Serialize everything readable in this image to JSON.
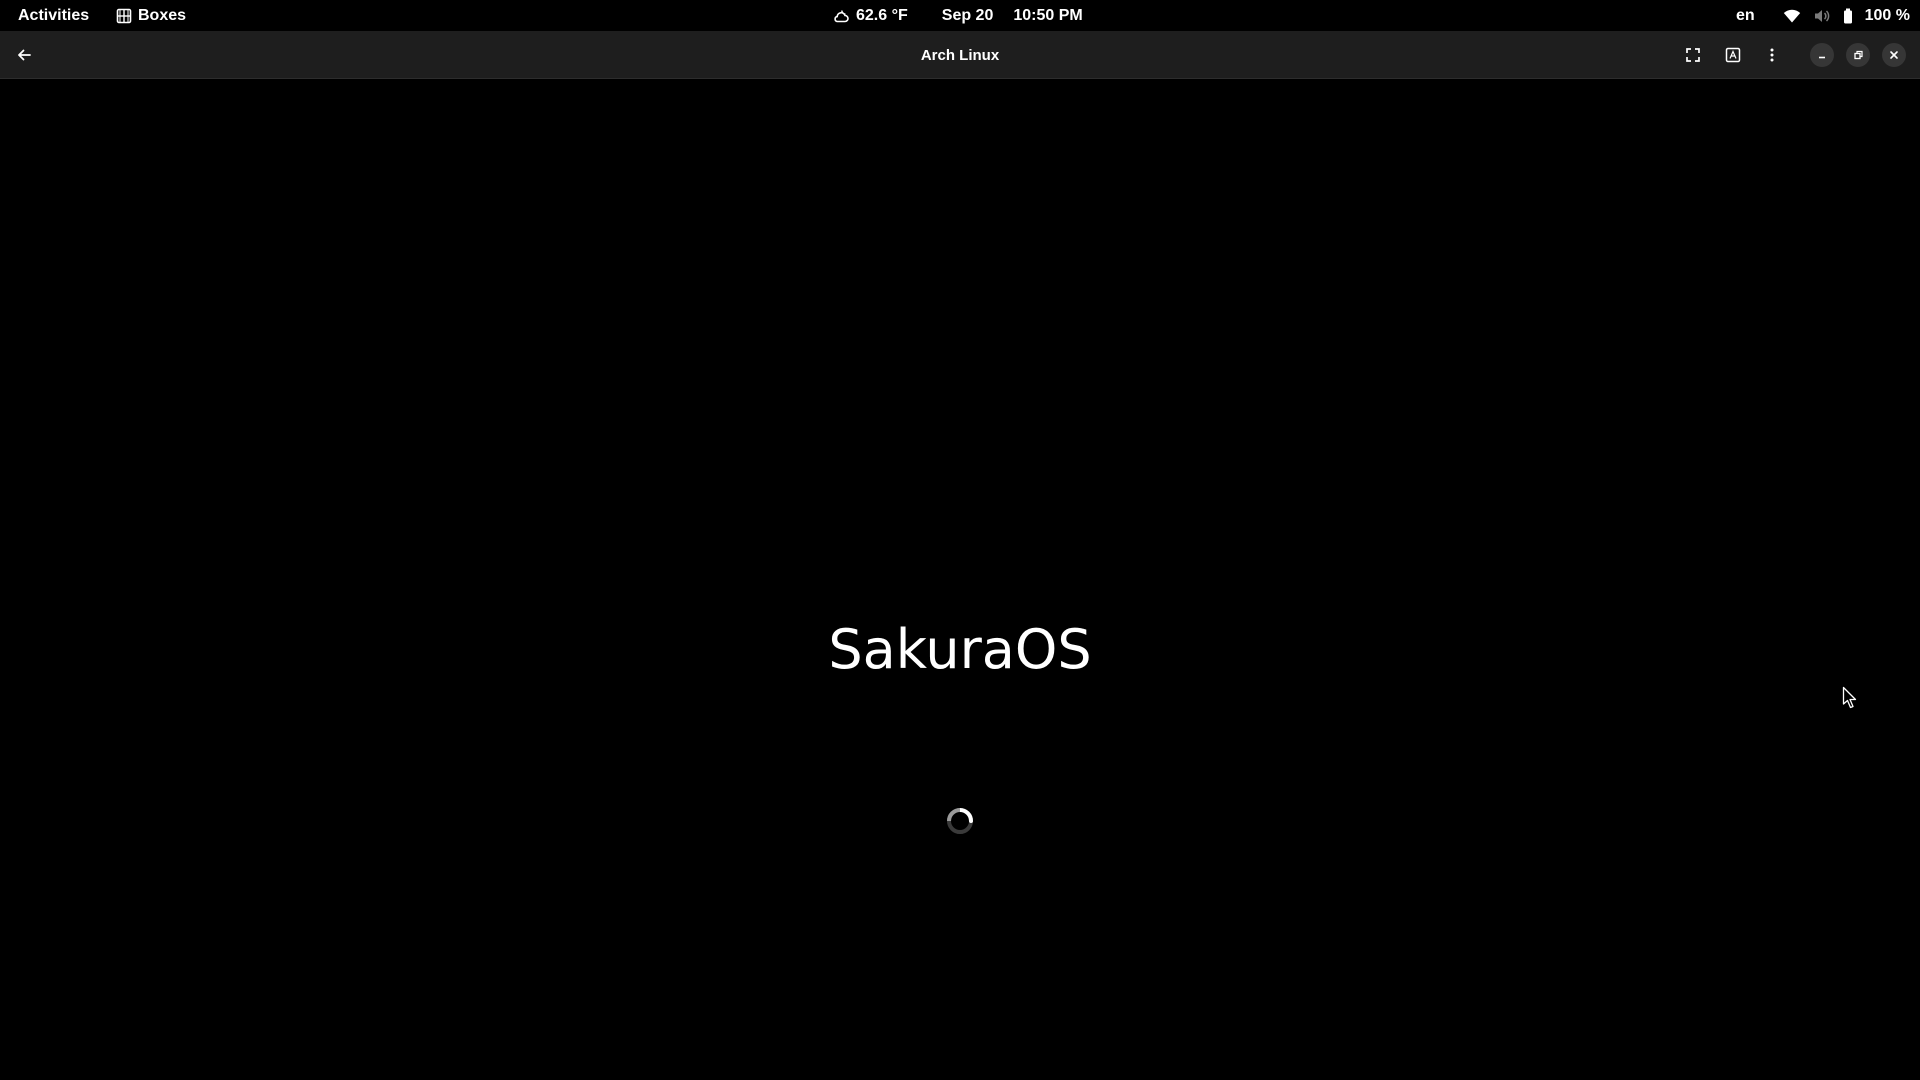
{
  "topbar": {
    "activities_label": "Activities",
    "app_name": "Boxes",
    "app_icon": "boxes-icon",
    "weather_icon": "weather-cloudy-night-icon",
    "weather_temp": "62.6 °F",
    "date": "Sep 20",
    "time": "10:50 PM",
    "keyboard_layout": "en",
    "wifi_icon": "wifi-icon",
    "volume_icon": "volume-muted-icon",
    "battery_icon": "battery-icon",
    "battery_level": "100 %"
  },
  "headerbar": {
    "title": "Arch Linux",
    "back_icon": "back-arrow-icon",
    "fullscreen_icon": "fullscreen-icon",
    "keyboard_icon": "send-keys-icon",
    "menu_icon": "more-vertical-icon",
    "minimize_icon": "minimize-icon",
    "maximize_icon": "restore-icon",
    "close_icon": "close-icon"
  },
  "vm_display": {
    "boot_logo_text": "SakuraOS",
    "spinner_icon": "loading-spinner-icon",
    "cursor_icon": "mouse-pointer-icon"
  },
  "colors": {
    "background": "#000000",
    "headerbar": "#1e1e1e",
    "text": "#ffffff",
    "window_button": "#363636"
  }
}
